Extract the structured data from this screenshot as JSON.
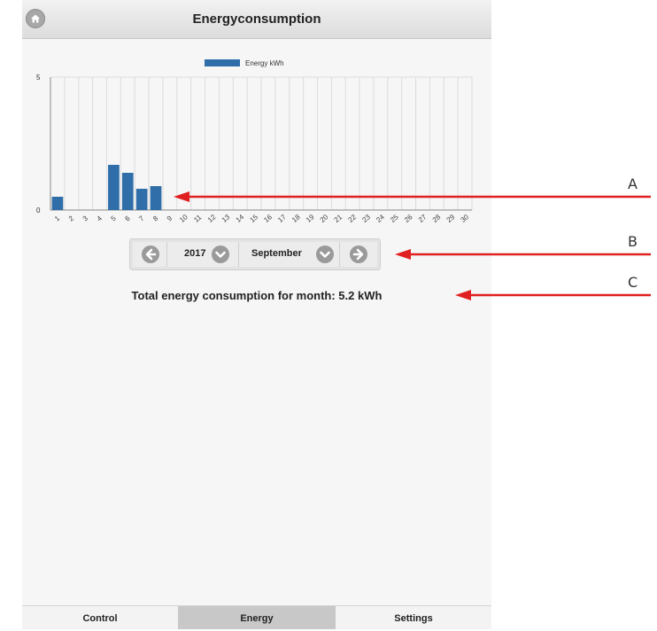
{
  "header": {
    "title": "Energyconsumption",
    "home_icon": "home-icon"
  },
  "chart_data": {
    "type": "bar",
    "legend": "Energy kWh",
    "legend_position": "top-center",
    "series_color": "#2f6ea8",
    "categories": [
      "1",
      "2",
      "3",
      "4",
      "5",
      "6",
      "7",
      "8",
      "9",
      "10",
      "11",
      "12",
      "13",
      "14",
      "15",
      "16",
      "17",
      "18",
      "19",
      "20",
      "21",
      "22",
      "23",
      "24",
      "25",
      "26",
      "27",
      "28",
      "29",
      "30"
    ],
    "values": [
      0.5,
      0,
      0,
      0,
      1.7,
      1.4,
      0.8,
      0.9,
      0,
      0,
      0,
      0,
      0,
      0,
      0,
      0,
      0,
      0,
      0,
      0,
      0,
      0,
      0,
      0,
      0,
      0,
      0,
      0,
      0,
      0
    ],
    "ylim": [
      0,
      5
    ],
    "yticks": [
      "0",
      "5"
    ],
    "grid": true
  },
  "nav": {
    "year": "2017",
    "month": "September",
    "prev_icon": "arrow-left-icon",
    "next_icon": "arrow-right-icon",
    "dropdown_icon": "chevron-down-icon"
  },
  "total": "Total energy consumption for month: 5.2 kWh",
  "tabs": [
    {
      "label": "Control"
    },
    {
      "label": "Energy"
    },
    {
      "label": "Settings"
    }
  ],
  "callouts": {
    "a": "A",
    "b": "B",
    "c": "C",
    "arrow_color": "#e02020"
  }
}
